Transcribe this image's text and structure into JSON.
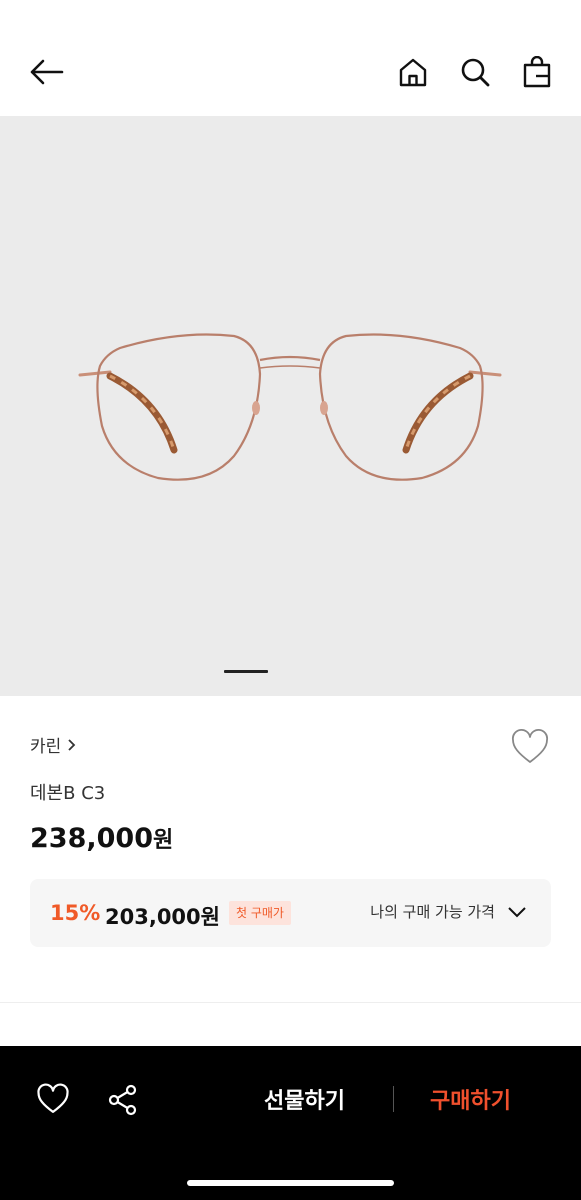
{
  "header": {
    "back_icon": "arrow-left-icon",
    "home_icon": "home-icon",
    "search_icon": "search-icon",
    "bag_icon": "shopping-bag-icon"
  },
  "product": {
    "brand": "카린",
    "name": "데본B C3",
    "price": "238,000",
    "price_unit": "원"
  },
  "promo": {
    "rate": "15%",
    "sale_price": "203,000원",
    "badge": "첫 구매가",
    "my_price_label": "나의 구매 가능 가격"
  },
  "bottom_bar": {
    "gift_label": "선물하기",
    "buy_label": "구매하기"
  },
  "colors": {
    "accent": "#f05a28",
    "hero_bg": "#ebebeb",
    "bar_bg": "#000000"
  }
}
